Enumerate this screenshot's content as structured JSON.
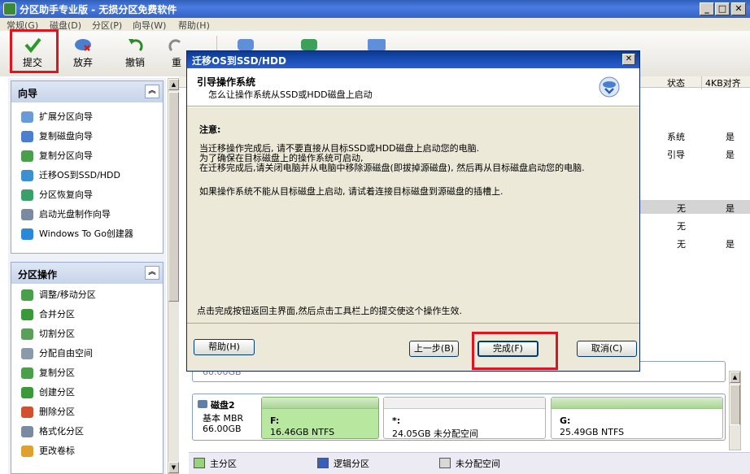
{
  "app": {
    "title": "分区助手专业版 - 无损分区免费软件",
    "window_buttons": [
      "_",
      "□",
      "✕"
    ]
  },
  "menu": [
    "常规(G)",
    "磁盘(D)",
    "分区(P)",
    "向导(W)",
    "帮助(H)"
  ],
  "toolbar": {
    "buttons": [
      "提交",
      "放弃",
      "撤销",
      "重"
    ]
  },
  "left": {
    "wizard_title": "向导",
    "wizard_items": [
      "扩展分区向导",
      "复制磁盘向导",
      "复制分区向导",
      "迁移OS到SSD/HDD",
      "分区恢复向导",
      "启动光盘制作向导",
      "Windows To Go创建器"
    ],
    "ops_title": "分区操作",
    "ops_items": [
      "调整/移动分区",
      "合并分区",
      "切割分区",
      "分配自由空间",
      "复制分区",
      "创建分区",
      "删除分区",
      "格式化分区",
      "更改卷标"
    ]
  },
  "table": {
    "headers": [
      "状态",
      "4KB对齐"
    ],
    "rows": [
      {
        "status": "系统",
        "align": "是"
      },
      {
        "status": "引导",
        "align": "是"
      },
      {
        "status": "无",
        "align": "是"
      },
      {
        "status": "无",
        "align": ""
      },
      {
        "status": "无",
        "align": "是"
      }
    ]
  },
  "disk1_size": "60.00GB",
  "disk2": {
    "name": "磁盘2",
    "type": "基本 MBR",
    "size": "66.00GB",
    "parts": [
      {
        "label": "F:",
        "size": "16.46GB NTFS",
        "color": "#b8e8a0"
      },
      {
        "label": "*:",
        "size": "24.05GB 未分配空间",
        "color": "#ffffff"
      },
      {
        "label": "G:",
        "size": "25.49GB NTFS",
        "color": "#ffffff"
      }
    ]
  },
  "legend": [
    "主分区",
    "逻辑分区",
    "未分配空间"
  ],
  "dialog": {
    "title": "迁移OS到SSD/HDD",
    "header_title": "引导操作系统",
    "header_sub": "怎么让操作系统从SSD或HDD磁盘上启动",
    "note_label": "注意:",
    "para1": [
      "当迁移操作完成后, 请不要直接从目标SSD或HDD磁盘上启动您的电脑.",
      "为了确保在目标磁盘上的操作系统可启动,",
      "在迁移完成后,请关闭电脑并从电脑中移除源磁盘(即拔掉源磁盘), 然后再从目标磁盘启动您的电脑."
    ],
    "para2": "如果操作系统不能从目标磁盘上启动, 请试着连接目标磁盘到源磁盘的插槽上.",
    "footer_note": "点击完成按钮返回主界面,然后点击工具栏上的提交使这个操作生效.",
    "buttons": {
      "help": "帮助(H)",
      "back": "上一步(B)",
      "finish": "完成(F)",
      "cancel": "取消(C)"
    }
  },
  "colors": {
    "highlight": "#e0141e",
    "title_blue": "#2f5fb7"
  }
}
